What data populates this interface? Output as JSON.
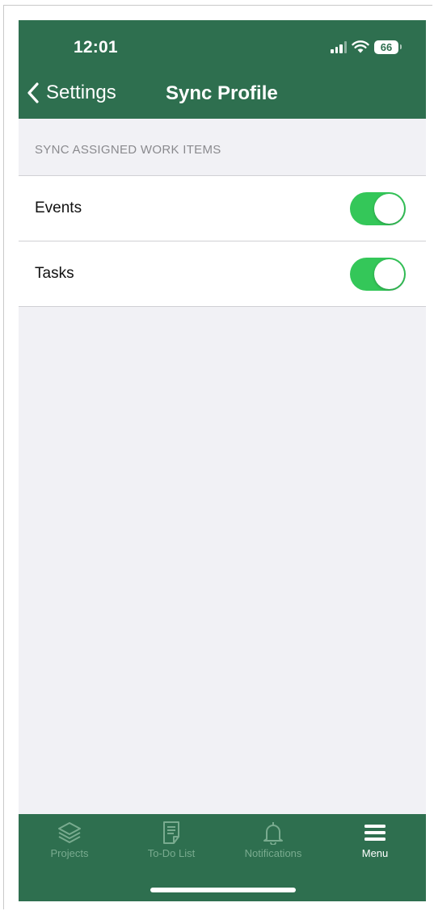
{
  "status_bar": {
    "time": "12:01",
    "battery": "66"
  },
  "nav": {
    "back_label": "Settings",
    "title": "Sync Profile"
  },
  "section": {
    "header": "SYNC ASSIGNED WORK ITEMS"
  },
  "rows": [
    {
      "label": "Events",
      "enabled": true
    },
    {
      "label": "Tasks",
      "enabled": true
    }
  ],
  "tabs": [
    {
      "label": "Projects",
      "icon": "layers-icon",
      "active": false
    },
    {
      "label": "To-Do List",
      "icon": "note-icon",
      "active": false
    },
    {
      "label": "Notifications",
      "icon": "bell-icon",
      "active": false
    },
    {
      "label": "Menu",
      "icon": "menu-icon",
      "active": true
    }
  ],
  "colors": {
    "brand": "#2e6f4f",
    "toggle_on": "#34c759",
    "background": "#f1f1f5"
  }
}
